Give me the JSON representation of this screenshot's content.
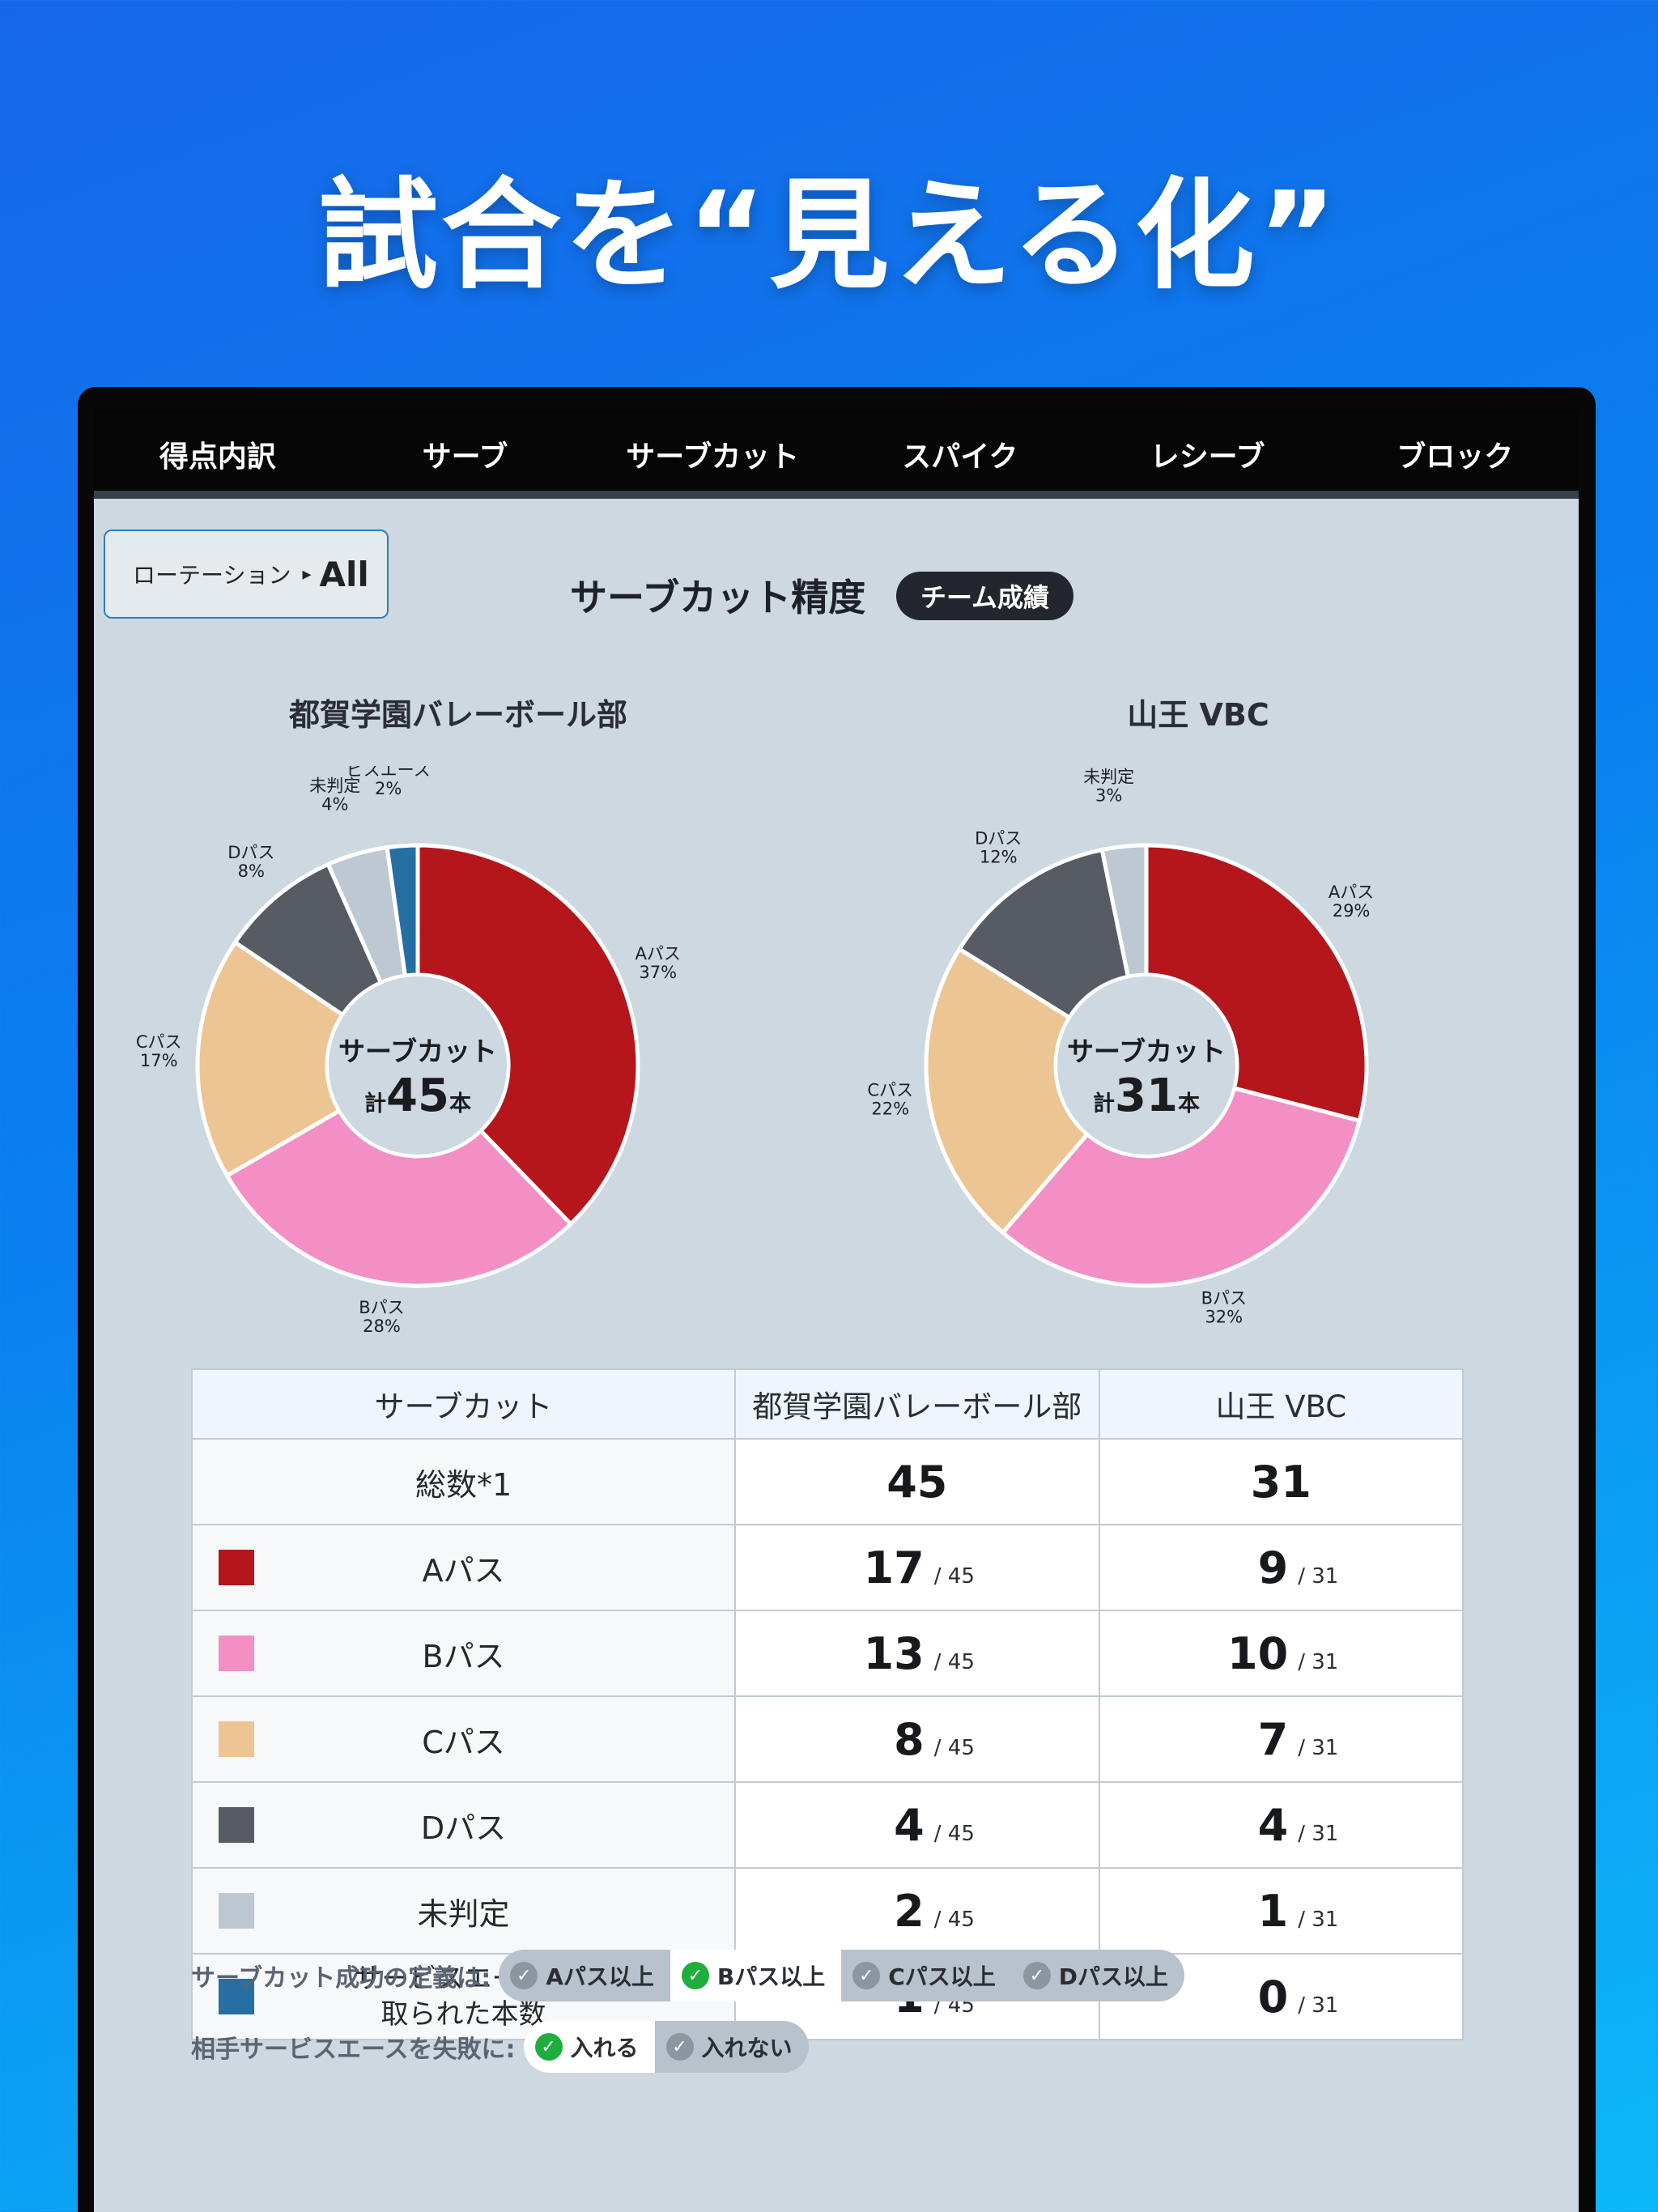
{
  "headline": "試合を“見える化”",
  "tabs": [
    "得点内訳",
    "サーブ",
    "サーブカット",
    "スパイク",
    "レシーブ",
    "ブロック"
  ],
  "active_tab": 2,
  "rotation": {
    "label": "ローテーション",
    "arrow": "▸",
    "value": "All"
  },
  "chart_title": "サーブカット精度",
  "badge": "チーム成績",
  "colors": {
    "A": "#b4161c",
    "B": "#f38fc4",
    "C": "#edc593",
    "D": "#575b63",
    "undetermined": "#bdc8d2",
    "ace": "#266fa2",
    "accent": "#2e7fb8"
  },
  "chart_data": [
    {
      "type": "pie",
      "title": "都賀学園バレーボール部",
      "center_label": "サーブカット",
      "center_prefix": "計",
      "center_total": "45",
      "center_unit": "本",
      "slices": [
        {
          "label": "Aパス",
          "pct_label": "37%",
          "value": 17
        },
        {
          "label": "Bパス",
          "pct_label": "28%",
          "value": 13
        },
        {
          "label": "Cパス",
          "pct_label": "17%",
          "value": 8
        },
        {
          "label": "Dパス",
          "pct_label": "8%",
          "value": 4
        },
        {
          "label": "未判定",
          "pct_label": "4%",
          "value": 2
        },
        {
          "label": "相手サーエース",
          "label_lines": [
            "相手サー",
            "ビスエース"
          ],
          "pct_label": "2%",
          "value": 1
        }
      ]
    },
    {
      "type": "pie",
      "title": "山王 VBC",
      "center_label": "サーブカット",
      "center_prefix": "計",
      "center_total": "31",
      "center_unit": "本",
      "slices": [
        {
          "label": "Aパス",
          "pct_label": "29%",
          "value": 9
        },
        {
          "label": "Bパス",
          "pct_label": "32%",
          "value": 10
        },
        {
          "label": "Cパス",
          "pct_label": "22%",
          "value": 7
        },
        {
          "label": "Dパス",
          "pct_label": "12%",
          "value": 4
        },
        {
          "label": "未判定",
          "pct_label": "3%",
          "value": 1
        }
      ]
    }
  ],
  "table": {
    "headers": [
      "サーブカット",
      "都賀学園バレーボール部",
      "山王 VBC"
    ],
    "total": {
      "label": "総数*1",
      "team1": "45",
      "team2": "31"
    },
    "rows": [
      {
        "label": "Aパス",
        "team1": "17",
        "team2": "9"
      },
      {
        "label": "Bパス",
        "team1": "13",
        "team2": "10"
      },
      {
        "label": "Cパス",
        "team1": "8",
        "team2": "7"
      },
      {
        "label": "Dパス",
        "team1": "4",
        "team2": "4"
      },
      {
        "label": "未判定",
        "team1": "2",
        "team2": "1"
      },
      {
        "label_line1": "サービスエースを",
        "label_line2": "取られた本数",
        "team1": "1",
        "team2": "0"
      }
    ],
    "of1": "/ 45",
    "of2": "/ 31"
  },
  "definition": {
    "label": "サーブカット成功の定義は:",
    "options": [
      "Aパス以上",
      "Bパス以上",
      "Cパス以上",
      "Dパス以上"
    ],
    "selected": 1
  },
  "ace_failure": {
    "label": "相手サービスエースを失敗に:",
    "options": [
      "入れる",
      "入れない"
    ],
    "selected": 0
  },
  "check_glyph": "✓"
}
